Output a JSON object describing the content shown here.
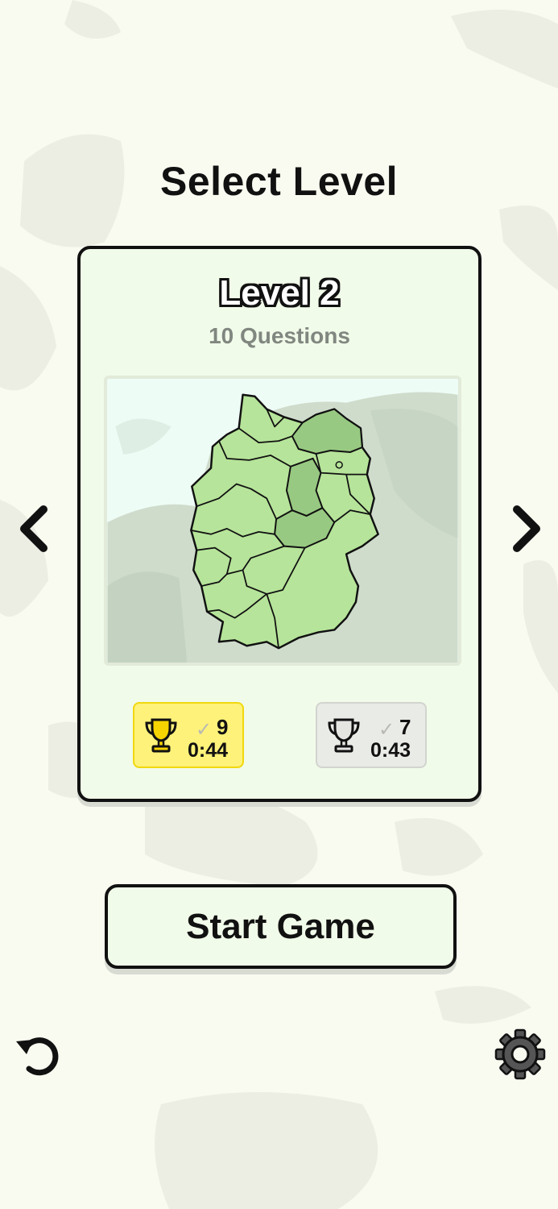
{
  "screen": {
    "title": "Select Level"
  },
  "level_card": {
    "name": "Level 2",
    "questions": "10 Questions",
    "map_icon": "germany-states-map"
  },
  "scores": {
    "gold": {
      "icon": "trophy-gold-icon",
      "check_icon": "check-icon",
      "count": "9",
      "time": "0:44"
    },
    "silver": {
      "icon": "trophy-silver-icon",
      "check_icon": "check-icon",
      "count": "7",
      "time": "0:43"
    }
  },
  "navigation": {
    "prev_icon": "chevron-left-icon",
    "next_icon": "chevron-right-icon"
  },
  "actions": {
    "start_label": "Start Game",
    "undo_icon": "undo-icon",
    "settings_icon": "gear-icon"
  },
  "colors": {
    "background": "#f9faf0",
    "card": "#f1fbe9",
    "gold": "#fff27a",
    "silver": "#e9ebe6",
    "map_highlight": "#a9d78d"
  }
}
